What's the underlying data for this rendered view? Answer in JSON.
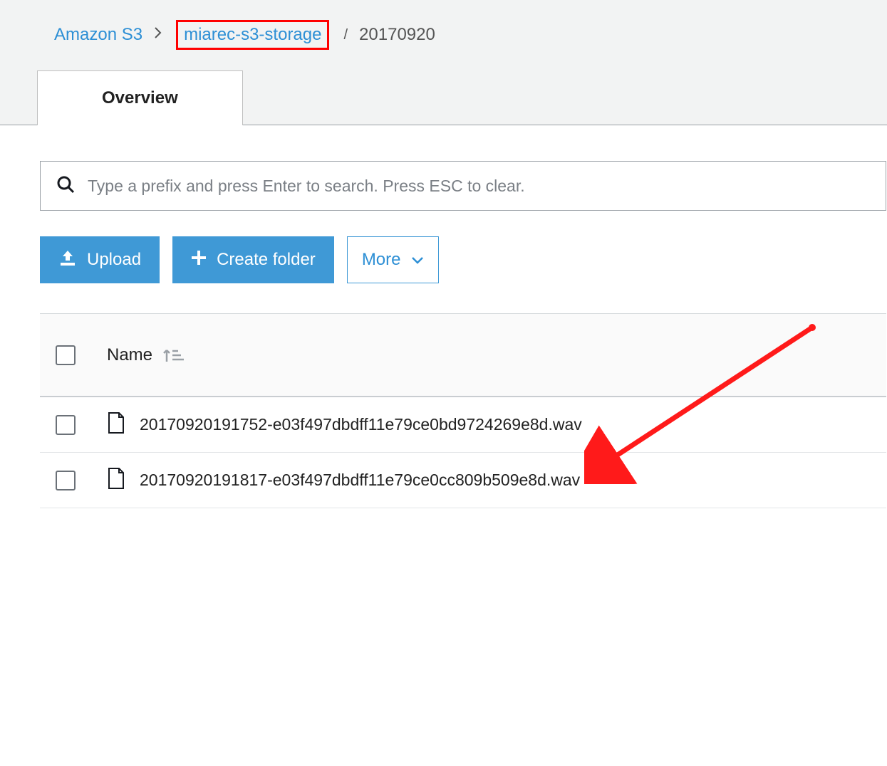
{
  "breadcrumb": {
    "root": "Amazon S3",
    "bucket": "miarec-s3-storage",
    "folder": "20170920"
  },
  "tabs": {
    "overview": "Overview"
  },
  "search": {
    "placeholder": "Type a prefix and press Enter to search. Press ESC to clear."
  },
  "toolbar": {
    "upload": "Upload",
    "create_folder": "Create folder",
    "more": "More"
  },
  "table": {
    "header_name": "Name",
    "rows": [
      {
        "name": "20170920191752-e03f497dbdff11e79ce0bd9724269e8d.wav"
      },
      {
        "name": "20170920191817-e03f497dbdff11e79ce0cc809b509e8d.wav"
      }
    ]
  },
  "annotations": {
    "highlighted_breadcrumb": "miarec-s3-storage",
    "arrow_target": "first file row"
  }
}
